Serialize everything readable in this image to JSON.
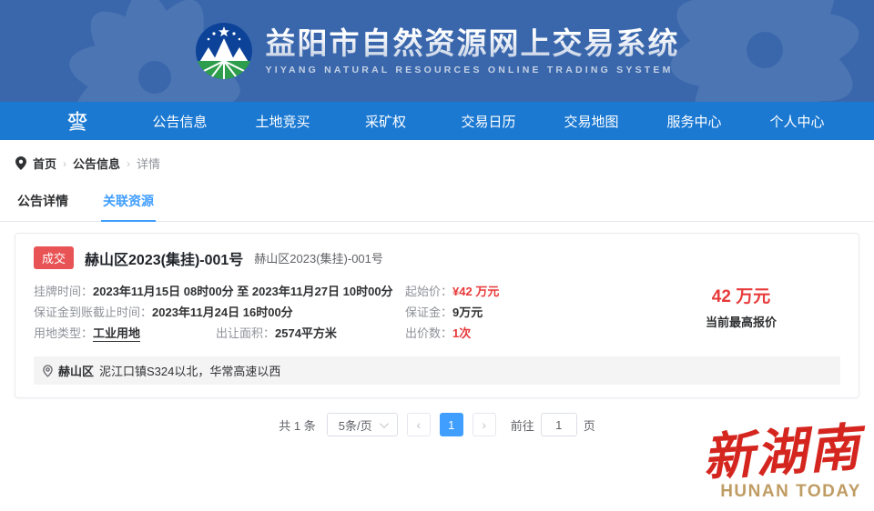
{
  "header": {
    "title": "益阳市自然资源网上交易系统",
    "subtitle": "YIYANG NATURAL RESOURCES ONLINE TRADING SYSTEM"
  },
  "nav": {
    "items": [
      {
        "label": "公告信息"
      },
      {
        "label": "土地竞买"
      },
      {
        "label": "采矿权"
      },
      {
        "label": "交易日历"
      },
      {
        "label": "交易地图"
      },
      {
        "label": "服务中心"
      },
      {
        "label": "个人中心"
      }
    ]
  },
  "breadcrumb": {
    "home": "首页",
    "section": "公告信息",
    "current": "详情",
    "separator": "›"
  },
  "tabs": [
    {
      "label": "公告详情",
      "active": false
    },
    {
      "label": "关联资源",
      "active": true
    }
  ],
  "listing": {
    "status_badge": "成交",
    "title": "赫山区2023(集挂)-001号",
    "subtitle": "赫山区2023(集挂)-001号",
    "listing_time_label": "挂牌时间：",
    "listing_time_value": "2023年11月15日 08时00分 至 2023年11月27日 10时00分",
    "deposit_deadline_label": "保证金到账截止时间：",
    "deposit_deadline_value": "2023年11月24日 16时00分",
    "land_type_label": "用地类型：",
    "land_type_value": "工业用地",
    "area_label": "出让面积：",
    "area_value": "2574平方米",
    "start_price_label": "起始价：",
    "start_price_value": "¥42 万元",
    "deposit_label": "保证金：",
    "deposit_value": "9万元",
    "bid_count_label": "出价数：",
    "bid_count_value": "1次",
    "current_bid_value": "42 万元",
    "current_bid_label": "当前最高报价",
    "location_district": "赫山区",
    "location_address": "泥江口镇S324以北，华常高速以西"
  },
  "pagination": {
    "total_text": "共 1 条",
    "page_size_text": "5条/页",
    "prev_icon": "‹",
    "next_icon": "›",
    "current_page": "1",
    "goto_label": "前往",
    "goto_value": "1",
    "goto_unit": "页"
  },
  "watermark": {
    "cn": "新湖南",
    "en": "HUNAN TODAY"
  },
  "colors": {
    "header_blue": "#3a67ac",
    "nav_blue": "#1b79d2",
    "accent_blue": "#409eff",
    "danger_red": "#e83a3a",
    "badge_red": "#e85455",
    "watermark_red": "#d4261f",
    "watermark_gold": "#bf9c63"
  }
}
